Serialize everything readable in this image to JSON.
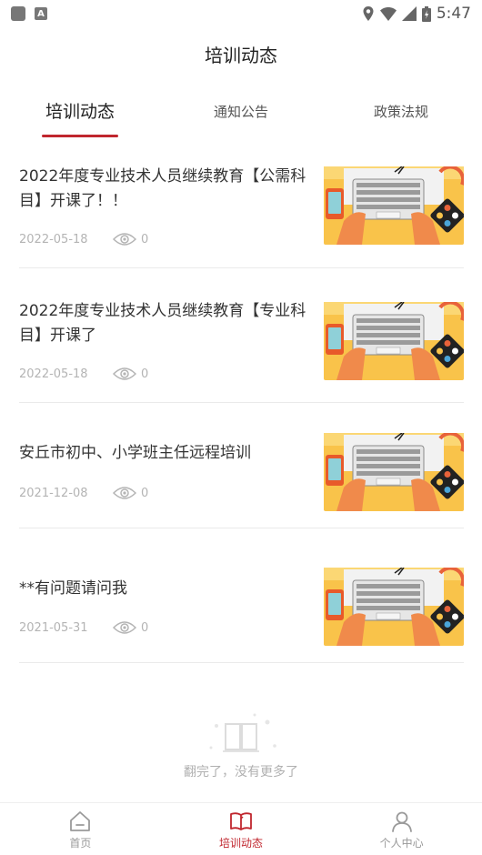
{
  "status_bar": {
    "time": "5:47"
  },
  "header": {
    "title": "培训动态"
  },
  "tabs": [
    {
      "label": "培训动态",
      "active": true
    },
    {
      "label": "通知公告",
      "active": false
    },
    {
      "label": "政策法规",
      "active": false
    }
  ],
  "news": [
    {
      "title": "2022年度专业技术人员继续教育【公需科目】开课了！！",
      "date": "2022-05-18",
      "views": "0",
      "thumb_icon": "laptop-keyboard-illustration"
    },
    {
      "title": "2022年度专业技术人员继续教育【专业科目】开课了",
      "date": "2022-05-18",
      "views": "0",
      "thumb_icon": "laptop-keyboard-illustration"
    },
    {
      "title": "安丘市初中、小学班主任远程培训",
      "date": "2021-12-08",
      "views": "0",
      "thumb_icon": "laptop-keyboard-illustration"
    },
    {
      "title": "**有问题请问我",
      "date": "2021-05-31",
      "views": "0",
      "thumb_icon": "laptop-keyboard-illustration"
    }
  ],
  "list_end": {
    "text": "翻完了，没有更多了"
  },
  "bottom_nav": [
    {
      "label": "首页",
      "icon": "home-icon",
      "active": false
    },
    {
      "label": "培训动态",
      "icon": "open-book-icon",
      "active": true
    },
    {
      "label": "个人中心",
      "icon": "user-icon",
      "active": false
    }
  ],
  "colors": {
    "accent": "#c0262e",
    "thumb_bg": "#f9c34a",
    "divider": "#eaeaea",
    "muted_text": "#b4b4b4"
  }
}
